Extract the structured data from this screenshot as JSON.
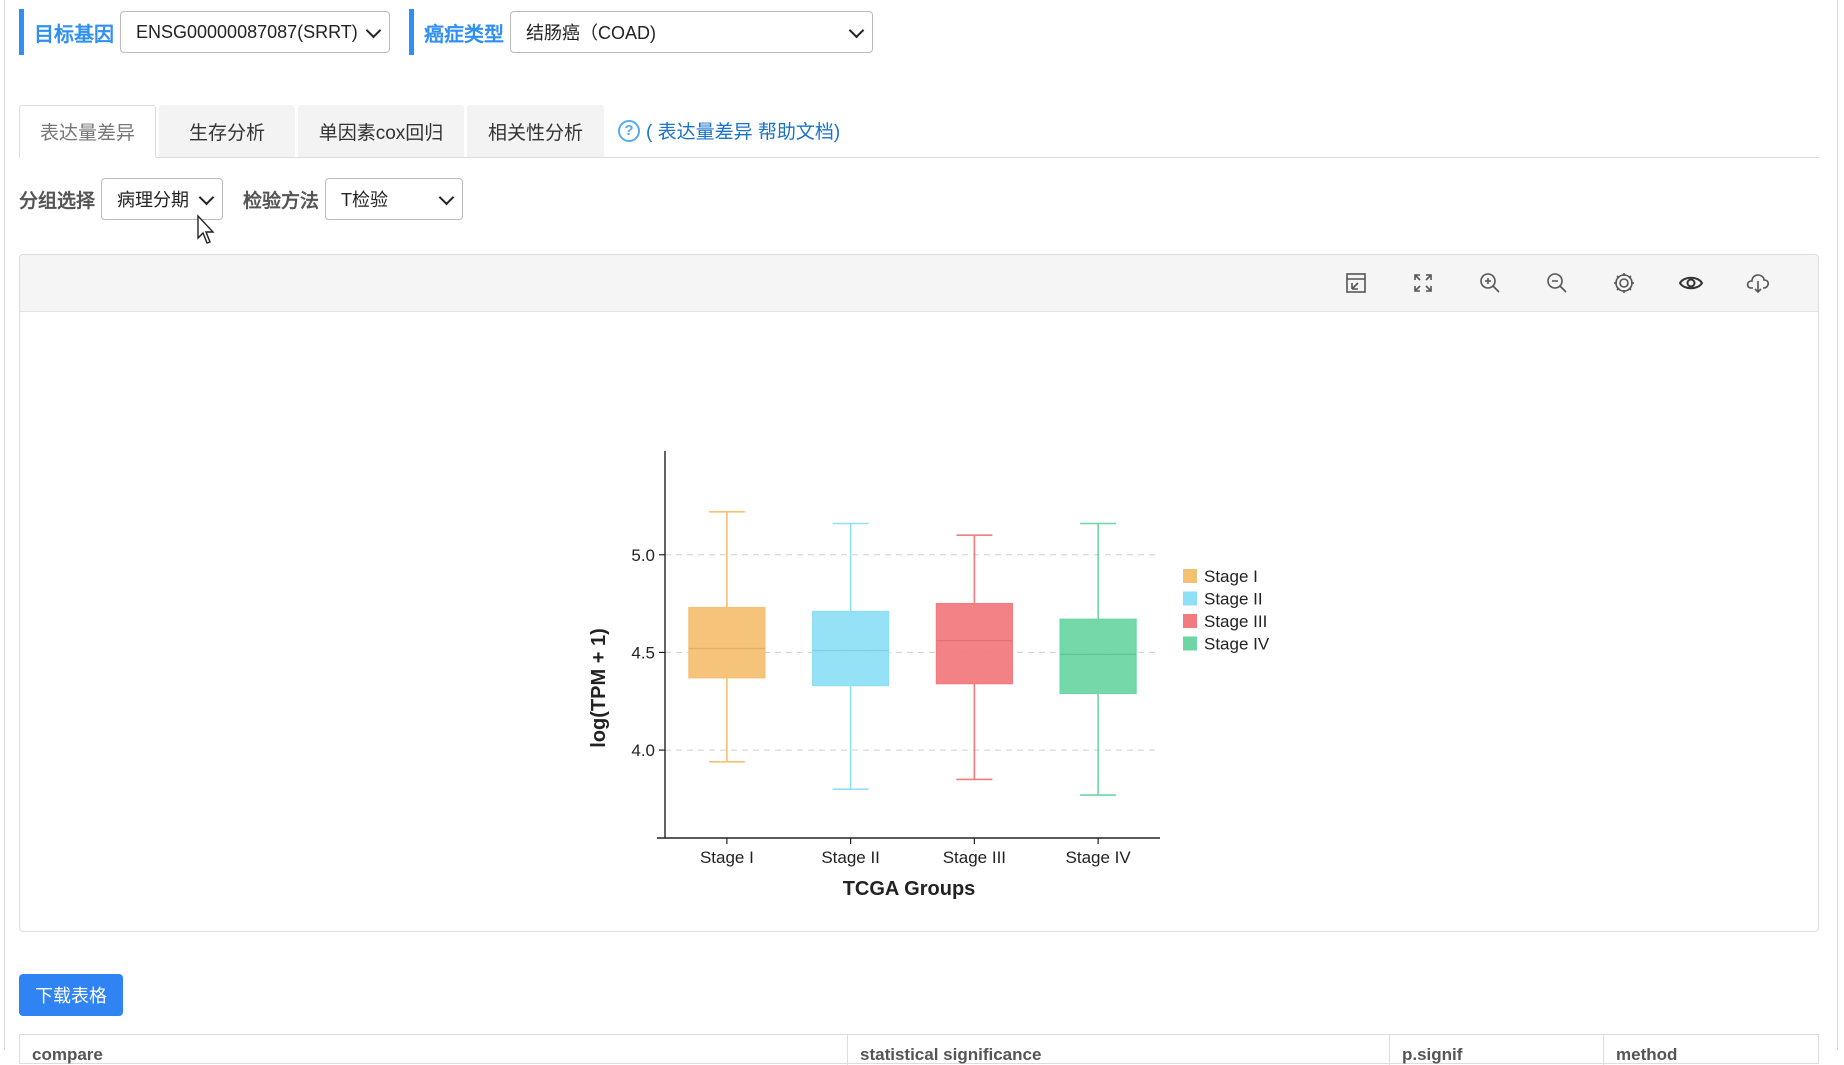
{
  "header": {
    "gene_label": "目标基因",
    "gene_value": "ENSG00000087087(SRRT)",
    "cancer_label": "癌症类型",
    "cancer_value": "结肠癌（COAD)"
  },
  "tabs": [
    {
      "label": "表达量差异",
      "active": true
    },
    {
      "label": "生存分析",
      "active": false
    },
    {
      "label": "单因素cox回归",
      "active": false
    },
    {
      "label": "相关性分析",
      "active": false
    }
  ],
  "help": {
    "icon": "question-circle-icon",
    "label": "( 表达量差异 帮助文档)"
  },
  "filters": {
    "group_label": "分组选择",
    "group_value": "病理分期",
    "test_label": "检验方法",
    "test_value": "T检验"
  },
  "toolbar_icons": [
    "restore-icon",
    "fullscreen-icon",
    "zoom-in-icon",
    "zoom-out-icon",
    "settings-icon",
    "eye-icon",
    "cloud-download-icon"
  ],
  "chart_data": {
    "type": "box",
    "title": "",
    "xlabel": "TCGA Groups",
    "ylabel": "log(TPM + 1)",
    "ylim": [
      3.55,
      5.48
    ],
    "yticks": [
      4.0,
      4.5,
      5.0
    ],
    "ytick_labels": [
      "4.0",
      "4.5",
      "5.0"
    ],
    "grid": "horizontal dashed",
    "legend_position": "right",
    "categories": [
      "Stage I",
      "Stage II",
      "Stage III",
      "Stage IV"
    ],
    "series": [
      {
        "name": "Stage I",
        "color": "#f4c072",
        "min": 3.94,
        "q1": 4.37,
        "median": 4.52,
        "q3": 4.73,
        "max": 5.22
      },
      {
        "name": "Stage II",
        "color": "#8fdff5",
        "min": 3.8,
        "q1": 4.33,
        "median": 4.51,
        "q3": 4.71,
        "max": 5.16
      },
      {
        "name": "Stage III",
        "color": "#f27b7f",
        "min": 3.85,
        "q1": 4.34,
        "median": 4.56,
        "q3": 4.75,
        "max": 5.1
      },
      {
        "name": "Stage IV",
        "color": "#6dd6a4",
        "min": 3.77,
        "q1": 4.29,
        "median": 4.49,
        "q3": 4.67,
        "max": 5.16
      }
    ]
  },
  "download_button": "下载表格",
  "table": {
    "headers": [
      "compare",
      "statistical significance",
      "p.signif",
      "method"
    ]
  }
}
